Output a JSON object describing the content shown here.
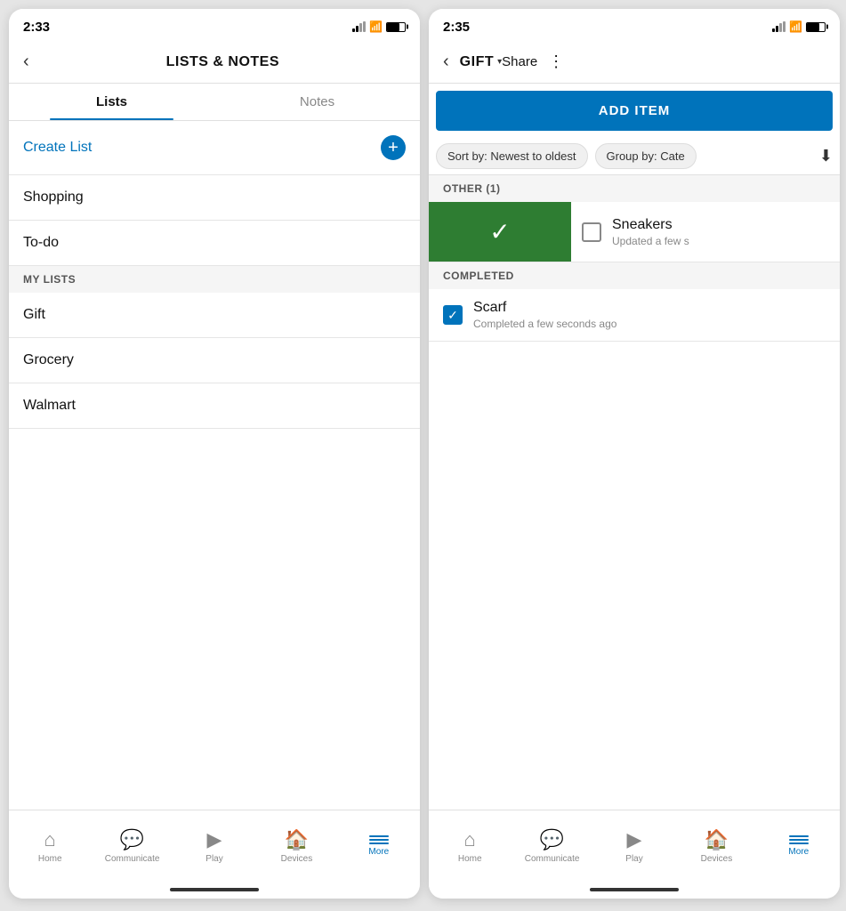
{
  "left_screen": {
    "status": {
      "time": "2:33",
      "location_icon": "▲"
    },
    "header": {
      "title": "LISTS & NOTES",
      "back_label": "‹"
    },
    "tabs": [
      {
        "label": "Lists",
        "active": true
      },
      {
        "label": "Notes",
        "active": false
      }
    ],
    "create_list": {
      "label": "Create List",
      "plus": "+"
    },
    "default_lists": [
      {
        "label": "Shopping"
      },
      {
        "label": "To-do"
      }
    ],
    "my_lists_header": "MY LISTS",
    "my_lists": [
      {
        "label": "Gift"
      },
      {
        "label": "Grocery"
      },
      {
        "label": "Walmart"
      }
    ],
    "nav": {
      "items": [
        {
          "label": "Home",
          "active": false
        },
        {
          "label": "Communicate",
          "active": false
        },
        {
          "label": "Play",
          "active": false
        },
        {
          "label": "Devices",
          "active": false
        },
        {
          "label": "More",
          "active": true
        }
      ]
    }
  },
  "right_screen": {
    "status": {
      "time": "2:35",
      "location_icon": "▲"
    },
    "header": {
      "back_label": "‹",
      "title": "GIFT",
      "share_label": "Share",
      "more_label": "⋮",
      "dropdown_arrow": "▾"
    },
    "add_item_btn": "ADD ITEM",
    "filters": [
      {
        "label": "Sort by: Newest to oldest"
      },
      {
        "label": "Group by: Cate"
      }
    ],
    "sort_icon": "⬇",
    "other_section": {
      "header": "OTHER (1)",
      "items": [
        {
          "name": "Sneakers",
          "subtitle": "Updated a few s",
          "checked": false,
          "swiped": true
        }
      ]
    },
    "completed_section": {
      "header": "COMPLETED",
      "items": [
        {
          "name": "Scarf",
          "subtitle": "Completed a few seconds ago",
          "checked": true
        }
      ]
    },
    "nav": {
      "items": [
        {
          "label": "Home",
          "active": false
        },
        {
          "label": "Communicate",
          "active": false
        },
        {
          "label": "Play",
          "active": false
        },
        {
          "label": "Devices",
          "active": false
        },
        {
          "label": "More",
          "active": true
        }
      ]
    }
  }
}
